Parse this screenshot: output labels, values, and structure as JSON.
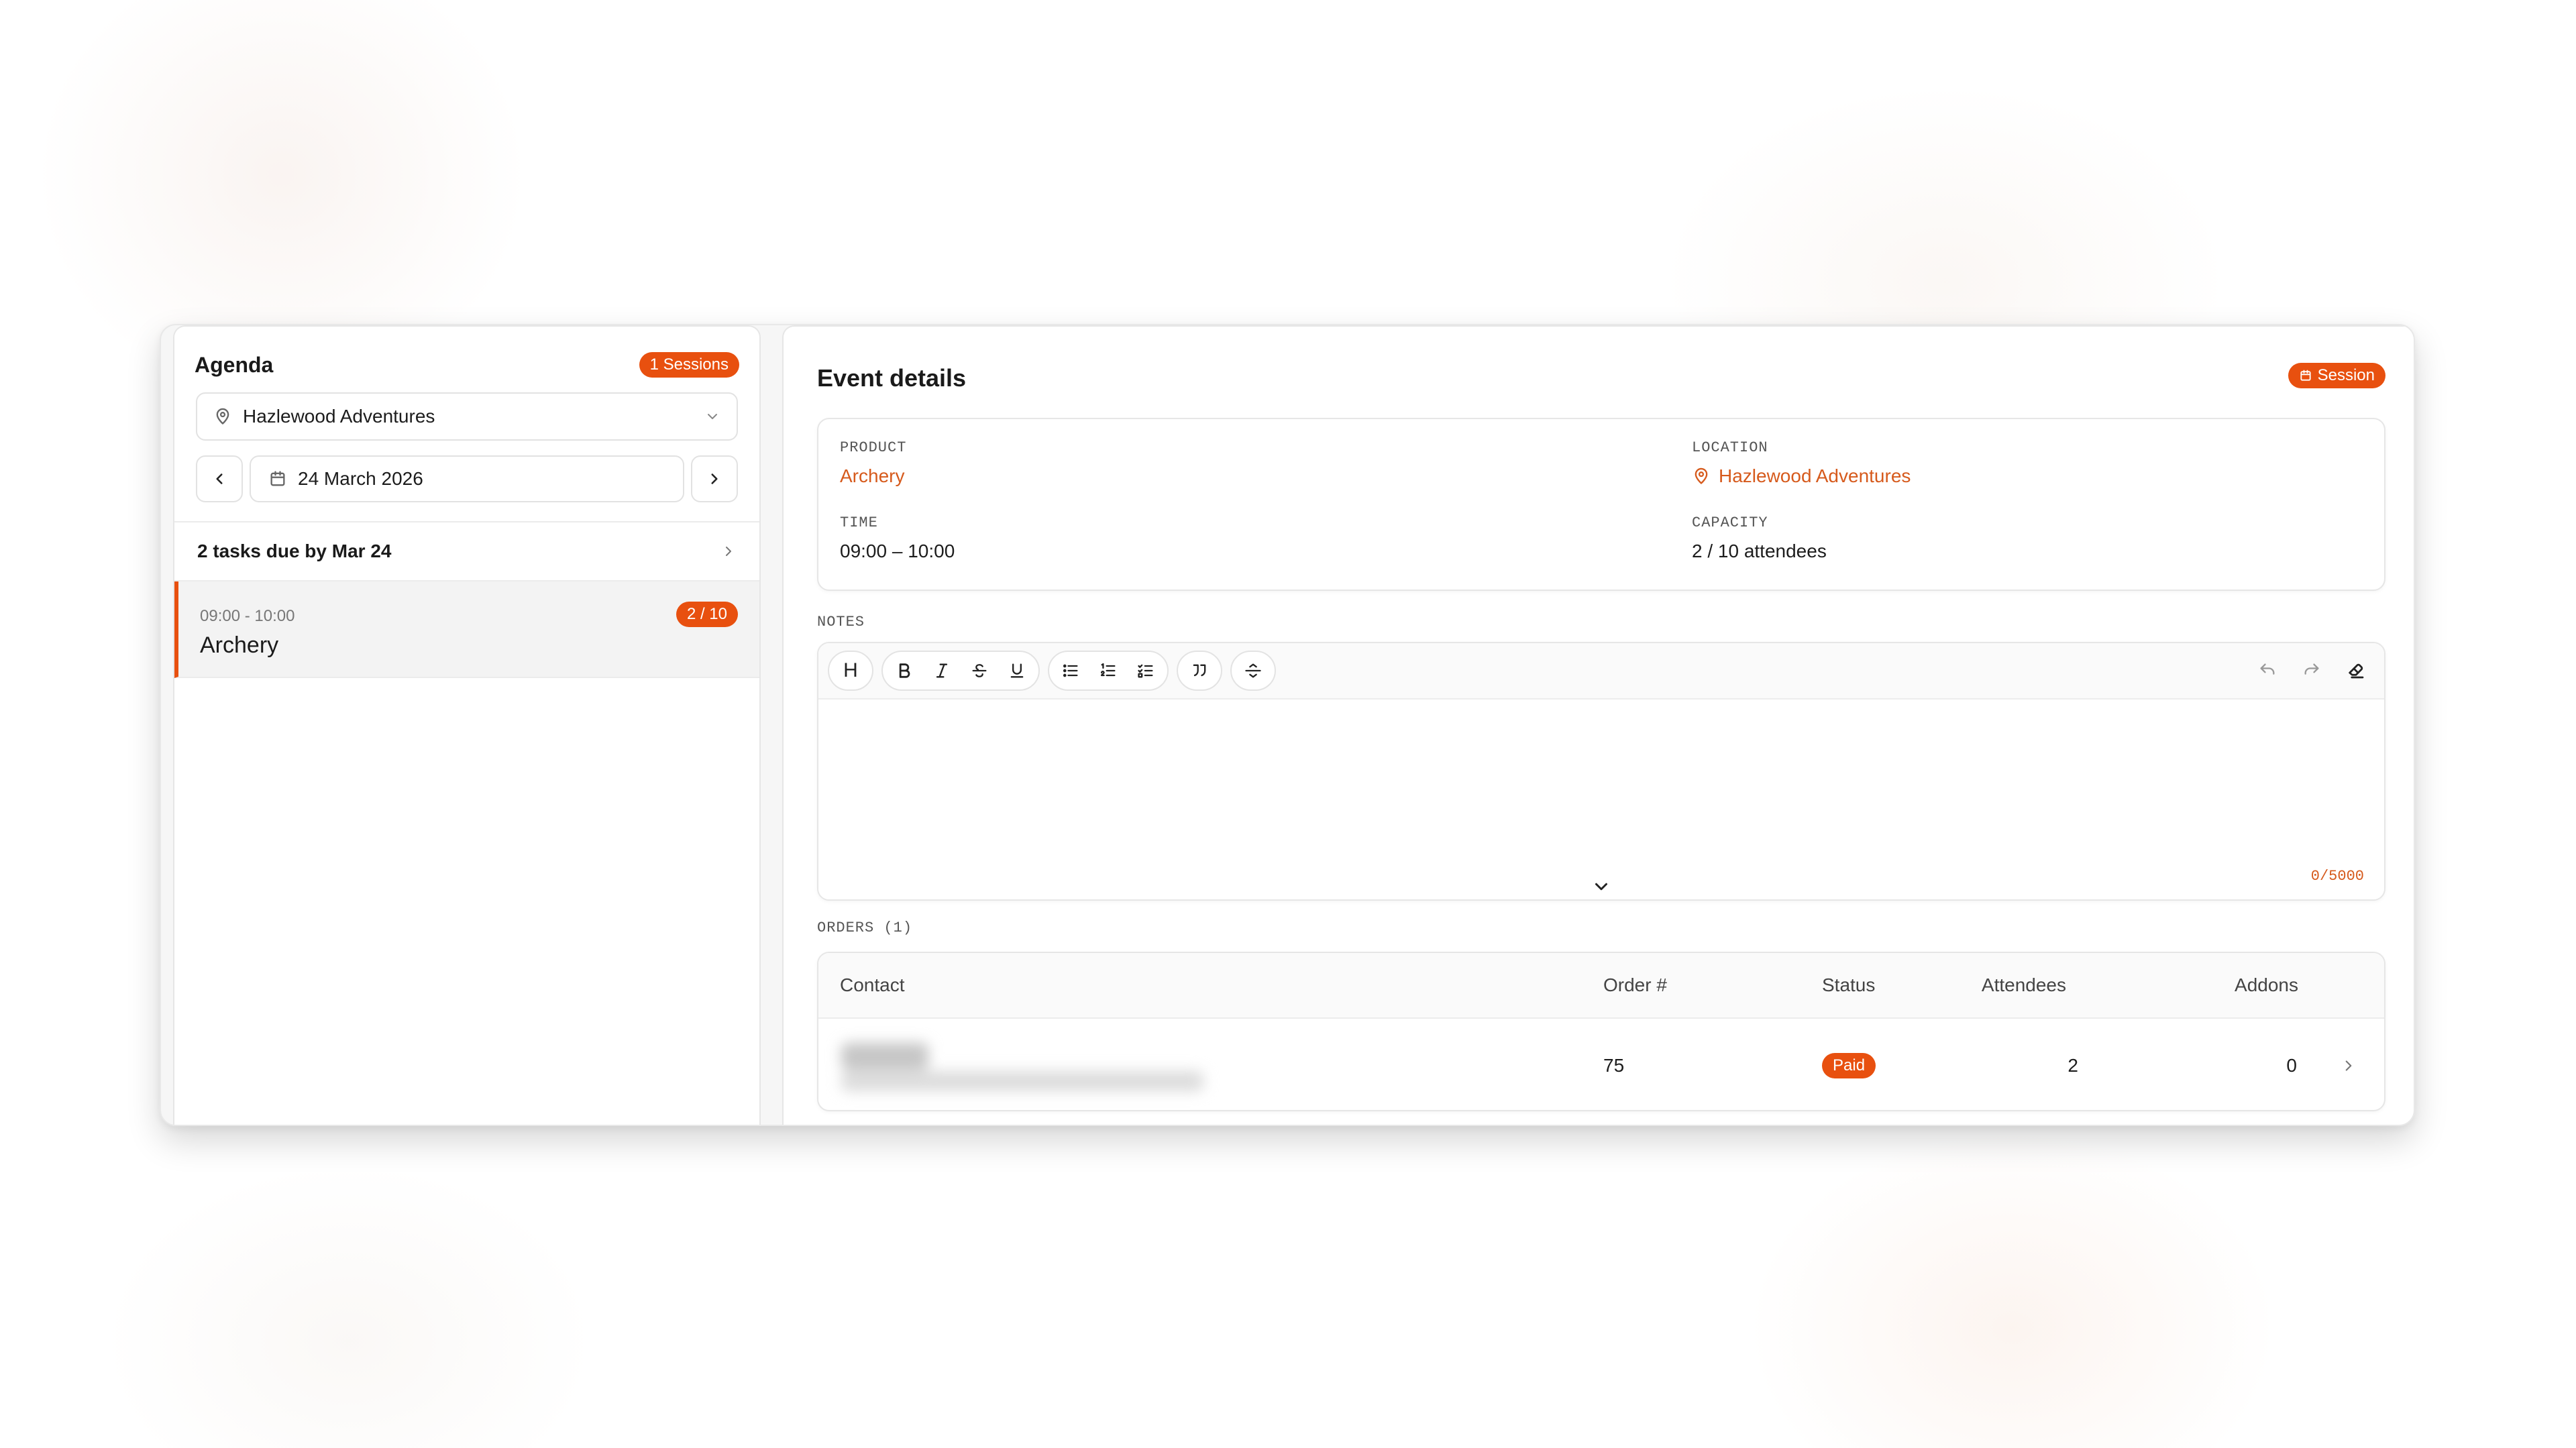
{
  "colors": {
    "accent": "#e8500f",
    "accent_text": "#d65a1c"
  },
  "sidebar": {
    "title": "Agenda",
    "sessions_badge": "1 Sessions",
    "location": "Hazlewood Adventures",
    "date": "24 March 2026",
    "tasks_label": "2 tasks due by Mar 24",
    "sessions": [
      {
        "time": "09:00 - 10:00",
        "name": "Archery",
        "capacity": "2 / 10"
      }
    ]
  },
  "main": {
    "title": "Event details",
    "badge": "Session",
    "details": {
      "product_label": "PRODUCT",
      "product_value": "Archery",
      "location_label": "LOCATION",
      "location_value": "Hazlewood Adventures",
      "time_label": "TIME",
      "time_value": "09:00 – 10:00",
      "capacity_label": "CAPACITY",
      "capacity_value": "2 / 10 attendees"
    },
    "notes": {
      "label": "NOTES",
      "counter": "0/5000",
      "heading_btn": "H"
    },
    "orders": {
      "label": "ORDERS (1)",
      "columns": [
        "Contact",
        "Order #",
        "Status",
        "Attendees",
        "Addons"
      ],
      "rows": [
        {
          "order": "75",
          "status": "Paid",
          "attendees": "2",
          "addons": "0"
        }
      ]
    }
  }
}
